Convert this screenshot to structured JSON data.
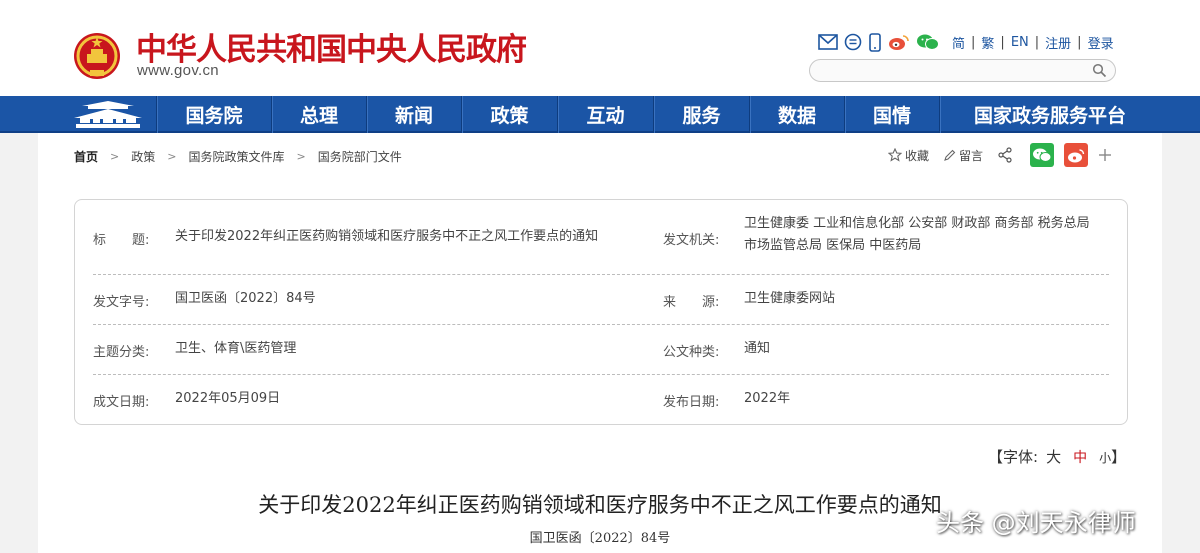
{
  "header": {
    "site_name": "中华人民共和国中央人民政府",
    "site_url": "www.gov.cn",
    "tools": [
      "mail-icon",
      "chat-bubble-icon",
      "mobile-icon",
      "weibo-icon",
      "wechat-icon"
    ],
    "lang_links": [
      "简",
      "繁",
      "EN",
      "注册",
      "登录"
    ],
    "search_placeholder": ""
  },
  "nav": {
    "items": [
      "国务院",
      "总理",
      "新闻",
      "政策",
      "互动",
      "服务",
      "数据",
      "国情",
      "国家政务服务平台"
    ]
  },
  "breadcrumb": [
    "首页",
    "政策",
    "国务院政策文件库",
    "国务院部门文件"
  ],
  "actions": {
    "favorite": "收藏",
    "comment": "留言"
  },
  "info": {
    "title_label": "标　　题:",
    "title_value": "关于印发2022年纠正医药购销领域和医疗服务中不正之风工作要点的通知",
    "issuer_label": "发文机关:",
    "issuer_value": "卫生健康委  工业和信息化部  公安部  财政部  商务部  税务总局  市场监管总局  医保局  中医药局",
    "doc_no_label": "发文字号:",
    "doc_no_value": "国卫医函〔2022〕84号",
    "source_label": "来　　源:",
    "source_value": "卫生健康委网站",
    "topic_label": "主题分类:",
    "topic_value": "卫生、体育\\医药管理",
    "type_label": "公文种类:",
    "type_value": "通知",
    "written_label": "成文日期:",
    "written_value": "2022年05月09日",
    "published_label": "发布日期:",
    "published_value": "2022年"
  },
  "font_size": {
    "prefix": "【字体:",
    "large": "大",
    "medium": "中",
    "small": "小",
    "suffix": "】"
  },
  "document": {
    "title": "关于印发2022年纠正医药购销领域和医疗服务中不正之风工作要点的通知",
    "number": "国卫医函〔2022〕84号"
  },
  "watermark": "头条 @刘天永律师",
  "colors": {
    "brand_red": "#c8161d",
    "nav_blue": "#1b55a6",
    "link_blue": "#1e56a0",
    "wechat_green": "#2bb24c",
    "weibo_orange": "#e8503a"
  }
}
